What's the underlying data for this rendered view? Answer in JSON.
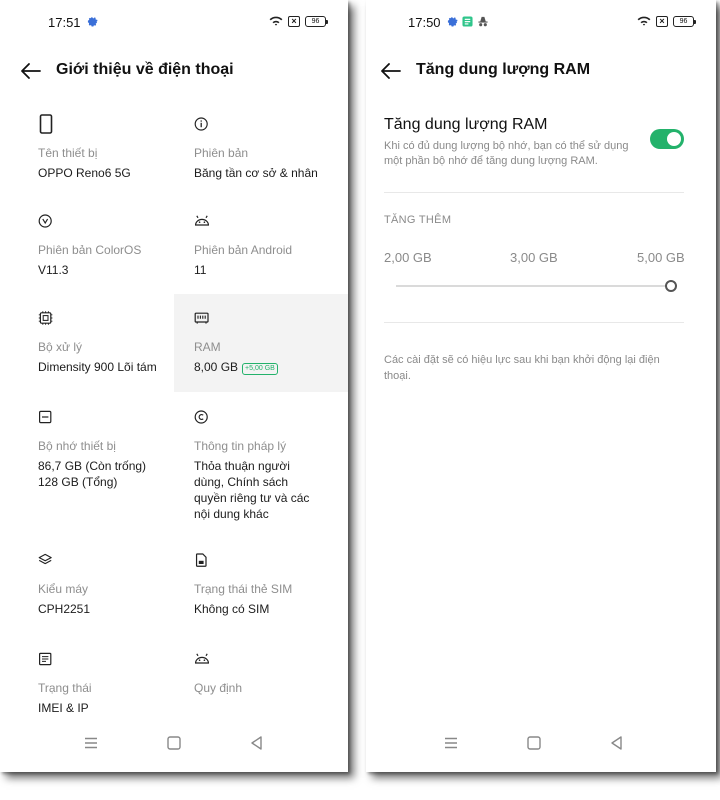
{
  "left": {
    "status": {
      "time": "17:51",
      "battery": "96",
      "xmark": "×"
    },
    "title": "Giới thiệu về điện thoại",
    "items": [
      {
        "icon": "phone-icon",
        "label": "Tên thiết bị",
        "value": "OPPO Reno6 5G"
      },
      {
        "icon": "info-icon",
        "label": "Phiên bản",
        "value": "Băng tần cơ sở & nhân"
      },
      {
        "icon": "coloros-icon",
        "label": "Phiên bản ColorOS",
        "value": "V11.3"
      },
      {
        "icon": "android-icon",
        "label": "Phiên bản Android",
        "value": "11"
      },
      {
        "icon": "cpu-icon",
        "label": "Bộ xử lý",
        "value": "Dimensity 900 Lõi tám"
      },
      {
        "icon": "ram-icon",
        "label": "RAM",
        "value": "8,00 GB",
        "badge": "+5,00 GB"
      },
      {
        "icon": "storage-icon",
        "label": "Bộ nhớ thiết bị",
        "value": "86,7 GB (Còn trống)",
        "value2": "128 GB (Tổng)"
      },
      {
        "icon": "copyright-icon",
        "label": "Thông tin pháp lý",
        "value": "Thỏa thuận người dùng, Chính sách quyền riêng tư và các nội dung khác"
      },
      {
        "icon": "layers-icon",
        "label": "Kiểu máy",
        "value": "CPH2251"
      },
      {
        "icon": "sim-icon",
        "label": "Trạng thái thẻ SIM",
        "value": "Không có SIM"
      },
      {
        "icon": "document-icon",
        "label": "Trạng thái",
        "value": "IMEI & IP"
      },
      {
        "icon": "android-icon",
        "label": "Quy định",
        "value": ""
      }
    ]
  },
  "right": {
    "status": {
      "time": "17:50",
      "battery": "96",
      "xmark": "×"
    },
    "title": "Tăng dung lượng RAM",
    "setting": {
      "title": "Tăng dung lượng RAM",
      "description": "Khi có đủ dung lượng bộ nhớ, bạn có thể sử dụng một phần bộ nhớ để tăng dung lượng RAM.",
      "enabled": true
    },
    "section_header": "TĂNG THÊM",
    "slider": {
      "options": [
        "2,00 GB",
        "3,00 GB",
        "5,00 GB"
      ],
      "selected_index": 2
    },
    "footnote": "Các cài đặt sẽ có hiệu lực sau khi bạn khởi động lại điện thoại."
  },
  "colors": {
    "accent": "#23b26b",
    "muted": "#8e8e8e",
    "highlight_bg": "#f3f3f3"
  }
}
